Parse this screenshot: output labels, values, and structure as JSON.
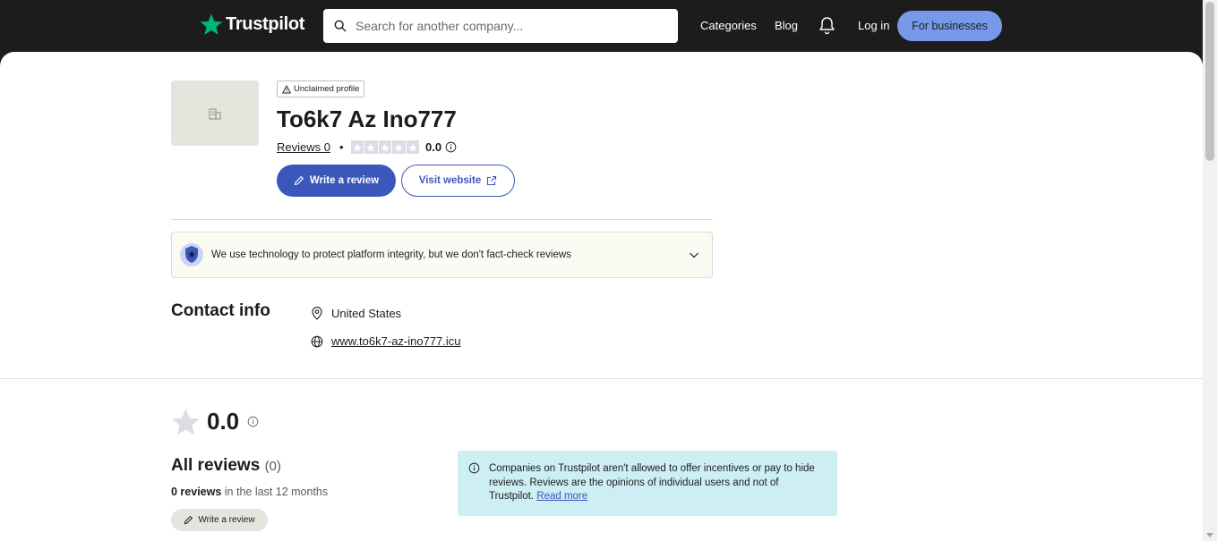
{
  "header": {
    "logo_text": "Trustpilot",
    "search_placeholder": "Search for another company...",
    "nav": {
      "categories": "Categories",
      "blog": "Blog",
      "login": "Log in"
    },
    "for_businesses": "For businesses"
  },
  "company": {
    "badge": "Unclaimed profile",
    "name": "To6k7 Az Ino777",
    "reviews_label": "Reviews 0",
    "rating": "0.0",
    "write_review": "Write a review",
    "visit_website": "Visit website"
  },
  "integrity": {
    "text": "We use technology to protect platform integrity, but we don't fact-check reviews"
  },
  "contact": {
    "title": "Contact info",
    "country": "United States",
    "website": "www.to6k7-az-ino777.icu"
  },
  "summary": {
    "rating": "0.0",
    "all_reviews": "All reviews",
    "count": "(0)",
    "reviews_count": "0 reviews",
    "period": " in the last 12 months",
    "write_review": "Write a review"
  },
  "notice": {
    "text": "Companies on Trustpilot aren't allowed to offer incentives or pay to hide reviews. Reviews are the opinions of individual users and not of Trustpilot. ",
    "link": "Read more"
  },
  "colors": {
    "brand_green": "#00b67a",
    "primary_blue": "#3c57bc",
    "business_blue": "#7899ea",
    "notice_bg": "#cdeef3"
  }
}
